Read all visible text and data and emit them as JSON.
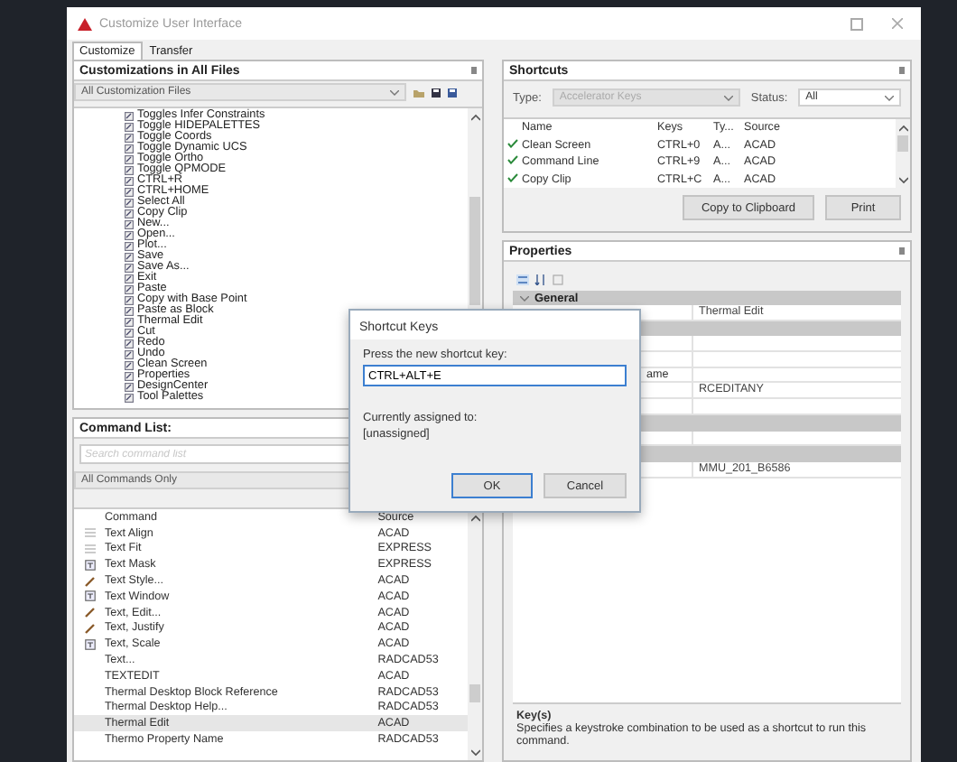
{
  "window": {
    "title": "Customize User Interface"
  },
  "tabs": [
    {
      "label": "Customize",
      "selected": true
    },
    {
      "label": "Transfer",
      "selected": false
    }
  ],
  "customizations": {
    "title": "Customizations in All Files",
    "filter": "All Customization Files",
    "tree_items": [
      "Toggles Infer Constraints",
      "Toggle HIDEPALETTES",
      "Toggle Coords",
      "Toggle Dynamic UCS",
      "Toggle Ortho",
      "Toggle QPMODE",
      "CTRL+R",
      "CTRL+HOME",
      "Select All",
      "Copy Clip",
      "New...",
      "Open...",
      "Plot...",
      "Save",
      "Save As...",
      "Exit",
      "Paste",
      "Copy with Base Point",
      "Paste as Block",
      "Thermal Edit",
      "Cut",
      "Redo",
      "Undo",
      "Clean Screen",
      "Properties",
      "DesignCenter",
      "Tool Palettes"
    ]
  },
  "command_list": {
    "title": "Command List:",
    "search_placeholder": "Search command list",
    "filter": "All Commands Only",
    "columns": [
      "Command",
      "Source"
    ],
    "rows": [
      {
        "command": "Text Align",
        "source": "ACAD",
        "kind": "lines",
        "selected": false
      },
      {
        "command": "Text Fit",
        "source": "EXPRESS",
        "kind": "lines",
        "selected": false
      },
      {
        "command": "Text Mask",
        "source": "EXPRESS",
        "kind": "box",
        "selected": false
      },
      {
        "command": "Text Style...",
        "source": "ACAD",
        "kind": "pen",
        "selected": false
      },
      {
        "command": "Text Window",
        "source": "ACAD",
        "kind": "box",
        "selected": false
      },
      {
        "command": "Text, Edit...",
        "source": "ACAD",
        "kind": "pen",
        "selected": false
      },
      {
        "command": "Text, Justify",
        "source": "ACAD",
        "kind": "pen",
        "selected": false
      },
      {
        "command": "Text, Scale",
        "source": "ACAD",
        "kind": "box",
        "selected": false
      },
      {
        "command": "Text...",
        "source": "RADCAD53",
        "selected": false
      },
      {
        "command": "TEXTEDIT",
        "source": "ACAD",
        "selected": false
      },
      {
        "command": "Thermal Desktop Block Reference",
        "source": "RADCAD53",
        "selected": false
      },
      {
        "command": "Thermal Desktop Help...",
        "source": "RADCAD53",
        "selected": false
      },
      {
        "command": "Thermal Edit",
        "source": "ACAD",
        "selected": true
      },
      {
        "command": "Thermo Property Name",
        "source": "RADCAD53",
        "selected": false
      }
    ]
  },
  "shortcuts": {
    "title": "Shortcuts",
    "type_label": "Type:",
    "type_value": "Accelerator Keys",
    "status_label": "Status:",
    "status_value": "All",
    "columns": [
      "Name",
      "Keys",
      "Ty...",
      "Source"
    ],
    "rows": [
      {
        "name": "Clean Screen",
        "keys": "CTRL+0",
        "type": "A...",
        "source": "ACAD"
      },
      {
        "name": "Command Line",
        "keys": "CTRL+9",
        "type": "A...",
        "source": "ACAD"
      },
      {
        "name": "Copy Clip",
        "keys": "CTRL+C",
        "type": "A...",
        "source": "ACAD"
      }
    ],
    "buttons": [
      "Copy to Clipboard",
      "Print"
    ]
  },
  "properties": {
    "title": "Properties",
    "section": "General",
    "rows": [
      {
        "kind": "prop",
        "value": "Thermal Edit"
      },
      {
        "kind": "section"
      },
      {
        "kind": "prop"
      },
      {
        "kind": "prop"
      },
      {
        "kind": "prop",
        "label": "ame"
      },
      {
        "kind": "prop",
        "value": "RCEDITANY"
      },
      {
        "kind": "prop"
      },
      {
        "kind": "section"
      },
      {
        "kind": "prop"
      },
      {
        "kind": "section"
      },
      {
        "kind": "prop",
        "value": "MMU_201_B6586"
      }
    ],
    "help_title": "Key(s)",
    "help_text": "Specifies a keystroke combination to be used as a shortcut to run this command."
  },
  "dialog": {
    "title": "Shortcut Keys",
    "prompt": "Press the new shortcut key:",
    "value": "CTRL+ALT+E",
    "assigned_label": "Currently assigned to:",
    "assigned_value": "[unassigned]",
    "buttons": [
      "OK",
      "Cancel"
    ]
  }
}
